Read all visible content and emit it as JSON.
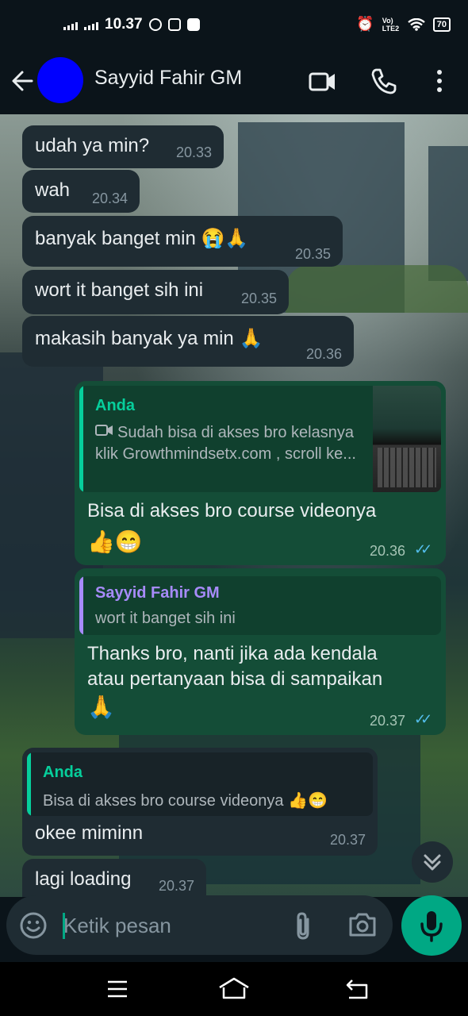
{
  "status_bar": {
    "time": "10.37",
    "volte": "Vo) LTE2",
    "battery": "70"
  },
  "header": {
    "contact_name": "Sayyid Fahir GM"
  },
  "messages": [
    {
      "text": "udah ya min?",
      "time": "20.33"
    },
    {
      "text": "wah",
      "time": "20.34"
    },
    {
      "text": "banyak banget min 😭🙏",
      "time": "20.35"
    },
    {
      "text": "wort it banget sih ini",
      "time": "20.35"
    },
    {
      "text": "makasih banyak ya min 🙏",
      "time": "20.36"
    },
    {
      "quote_author": "Anda",
      "quote_text": "Sudah bisa di akses bro kelasnya klik Growthmindsetx.com , scroll ke...",
      "line1": "Bisa di akses bro course videonya",
      "line2": "👍😁",
      "time": "20.36"
    },
    {
      "quote_author": "Sayyid Fahir GM",
      "quote_text": "wort it banget sih ini",
      "line1": "Thanks bro, nanti jika ada kendala",
      "line2": "atau pertanyaan bisa di sampaikan",
      "line3": "🙏",
      "time": "20.37"
    },
    {
      "quote_author": "Anda",
      "quote_text": "Bisa di akses bro course videonya 👍😁",
      "text": "okee miminn",
      "time": "20.37"
    },
    {
      "text": "lagi loading",
      "time": "20.37"
    }
  ],
  "composer": {
    "placeholder": "Ketik pesan"
  },
  "colors": {
    "accent": "#00a884",
    "incoming": "#1f2c33",
    "outgoing": "#144d37",
    "avatar": "#0000ff",
    "read_ticks": "#53bdeb"
  }
}
